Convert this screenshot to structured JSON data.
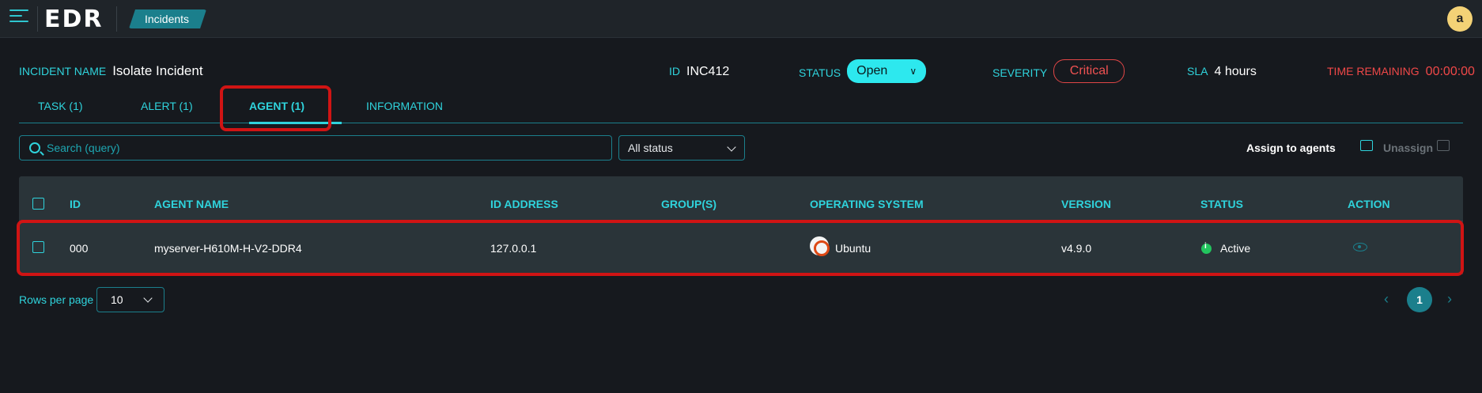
{
  "app": {
    "logo": "EDR",
    "breadcrumb": "Incidents",
    "user_initial": "a"
  },
  "incident": {
    "name_label": "INCIDENT NAME",
    "name": "Isolate Incident",
    "id_label": "ID",
    "id": "INC412",
    "status_label": "STATUS",
    "status": "Open",
    "severity_label": "SEVERITY",
    "severity": "Critical",
    "sla_label": "SLA",
    "sla": "4 hours",
    "time_remaining_label": "TIME REMAINING",
    "time_remaining": "00:00:00"
  },
  "tabs": [
    {
      "label": "TASK (1)"
    },
    {
      "label": "ALERT (1)"
    },
    {
      "label": "AGENT (1)",
      "active": true
    },
    {
      "label": "INFORMATION"
    }
  ],
  "toolbar": {
    "search_placeholder": "Search (query)",
    "status_filter": "All status",
    "assign_label": "Assign to agents",
    "unassign_label": "Unassign"
  },
  "table": {
    "columns": [
      "ID",
      "AGENT NAME",
      "ID ADDRESS",
      "GROUP(S)",
      "OPERATING SYSTEM",
      "VERSION",
      "STATUS",
      "ACTION"
    ],
    "rows": [
      {
        "id": "000",
        "agent_name": "myserver-H610M-H-V2-DDR4",
        "ip": "127.0.0.1",
        "groups": "",
        "os": "Ubuntu",
        "version": "v4.9.0",
        "status": "Active"
      }
    ]
  },
  "pagination": {
    "rows_per_page_label": "Rows per page",
    "rows_per_page": "10",
    "current_page": "1",
    "prev": "‹",
    "next": "›"
  },
  "colors": {
    "accent": "#2fd3dc",
    "teal": "#1b7f8c",
    "danger": "#f04848",
    "highlight": "#d01414",
    "active": "#22c55e"
  }
}
